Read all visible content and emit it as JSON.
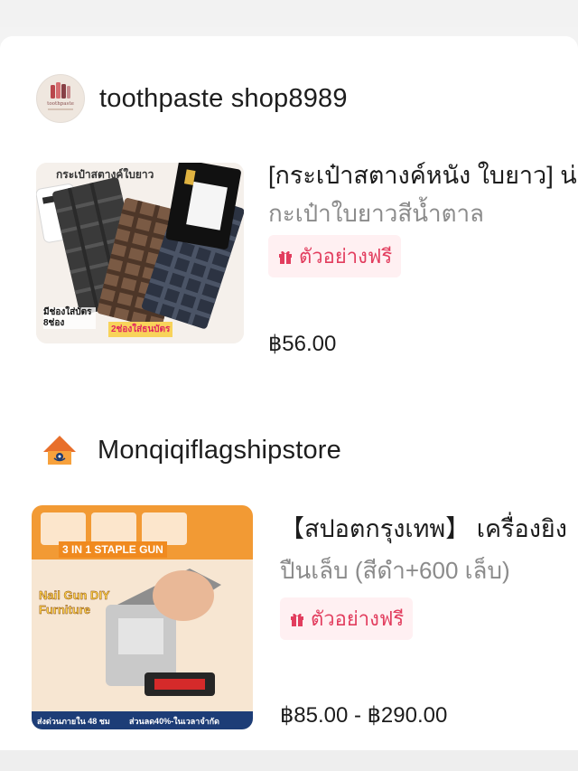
{
  "shops": [
    {
      "name": "toothpaste shop8989",
      "avatar_text": "toothpaste",
      "product": {
        "title": "[กระเป๋าสตางค์หนัง ใบยาว] น่",
        "variant": "กะเป๋าใบยาวสีน้ำตาล",
        "badge": "ตัวอย่างฟรี",
        "price": "฿56.00",
        "thumb_labels": {
          "top": "กระเป๋าสตางค์ใบยาว",
          "left": "มีช่องใส่บัตร 8ช่อง",
          "right": "2ช่องใส่ธนบัตร"
        }
      }
    },
    {
      "name": "Monqiqiflagshipstore",
      "product": {
        "title": "【สปอตกรุงเทพ】 เครื่องยิง",
        "variant": "ปืนเล็บ  (สีดำ+600 เล็บ)",
        "badge": "ตัวอย่างฟรี",
        "price": "฿85.00 - ฿290.00",
        "thumb_labels": {
          "banner": "3 IN 1 STAPLE GUN",
          "side": "Nail Gun DIY Furniture",
          "bottom_left": "ส่งด่วนภายใน 48 ชม",
          "bottom_right": "ส่วนลด40%-ในเวลาจำกัด"
        }
      }
    }
  ],
  "colors": {
    "badge_text": "#e23d5e",
    "badge_bg": "#fff0f2",
    "secondary_text": "#8b8b8b"
  },
  "icons": {
    "badge_icon": "gift-icon",
    "shop2_avatar": "house-icon"
  }
}
